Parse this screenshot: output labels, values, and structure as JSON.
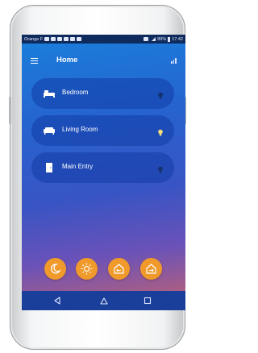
{
  "statusbar": {
    "carrier": "Orange F",
    "battery_text": "89%",
    "time": "17:42"
  },
  "appbar": {
    "title": "Home"
  },
  "rooms": [
    {
      "label": "Bedroom",
      "icon": "bed-icon",
      "light_on": false
    },
    {
      "label": "Living Room",
      "icon": "sofa-icon",
      "light_on": true
    },
    {
      "label": "Main Entry",
      "icon": "door-icon",
      "light_on": false
    }
  ],
  "actions": [
    {
      "icon": "moon-icon"
    },
    {
      "icon": "sun-icon"
    },
    {
      "icon": "arrive-home-icon"
    },
    {
      "icon": "leave-home-icon"
    }
  ],
  "navbar": {
    "icons": [
      "back-icon",
      "home-icon",
      "recents-icon"
    ]
  },
  "colors": {
    "accent_orange": "#f09a2c",
    "bulb_on": "#f7e07a",
    "bulb_off": "#15306e",
    "statusbar_bg": "#0f2a5c"
  }
}
